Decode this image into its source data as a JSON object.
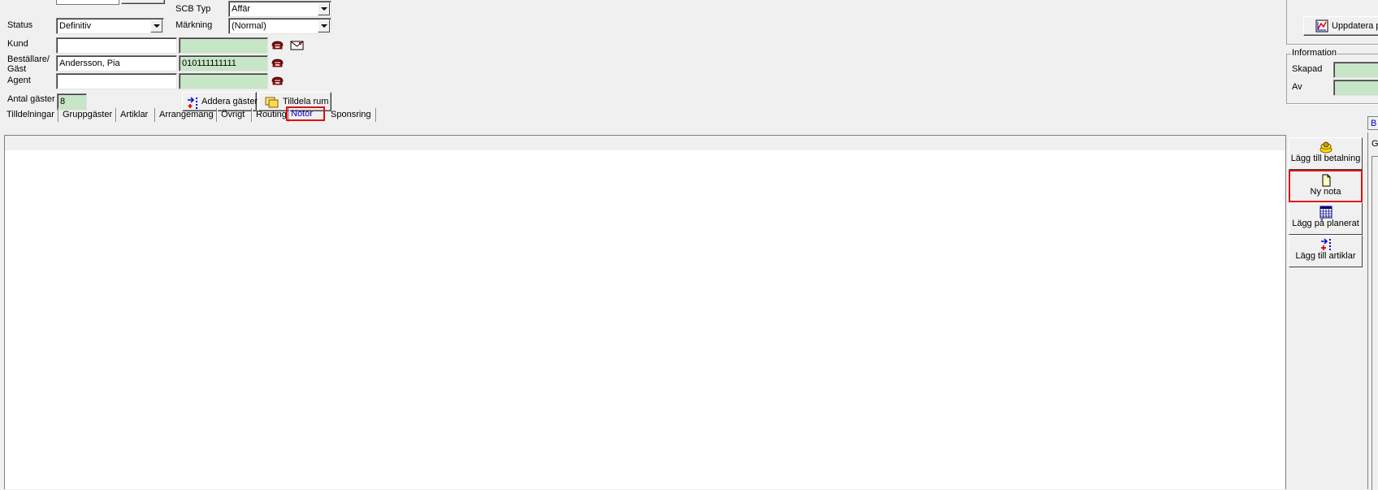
{
  "form": {
    "scb_typ_label": "SCB Typ",
    "scb_typ_value": "Affär",
    "status_label": "Status",
    "status_value": "Definitiv",
    "markning_label": "Märkning",
    "markning_value": "(Normal)",
    "kund_label": "Kund",
    "kund_value": "",
    "kund_extra": "",
    "bestallare_label_1": "Beställare/",
    "bestallare_label_2": "Gäst",
    "bestallare_value": "Andersson, Pia",
    "bestallare_extra": "010111111111",
    "agent_label": "Agent",
    "agent_value": "",
    "agent_extra": "",
    "antal_label": "Antal gäster",
    "antal_value": "8",
    "addera_label": "Addera gäster",
    "tilldela_label": "Tilldela rum"
  },
  "tabs": [
    "Tilldelningar",
    "Gruppgäster",
    "Artiklar",
    "Arrangemang",
    "Övrigt",
    "Routing",
    "Notor",
    "Sponsring"
  ],
  "active_tab": "Notor",
  "side_buttons": {
    "add_payment": "Lägg till betalning",
    "new_note": "Ny nota",
    "add_planned": "Lägg på planerat",
    "add_articles": "Lägg till artiklar"
  },
  "right_panel": {
    "update_label": "Uppdatera p",
    "info_title": "Information",
    "skapad_label": "Skapad",
    "av_label": "Av",
    "tab_partial": "B",
    "panel_partial": "G"
  },
  "icons": {
    "phone": "phone-icon",
    "envelope": "envelope-icon",
    "add_guests": "add-guests-icon",
    "assign_room": "assign-room-icon",
    "payment": "payment-icon",
    "note": "note-icon",
    "calendar": "calendar-icon",
    "add_items": "add-items-icon",
    "chart": "chart-icon"
  },
  "colors": {
    "highlight_border": "#dd1111",
    "readonly_green": "#c7e5c7",
    "active_tab_text": "#0000cc"
  }
}
